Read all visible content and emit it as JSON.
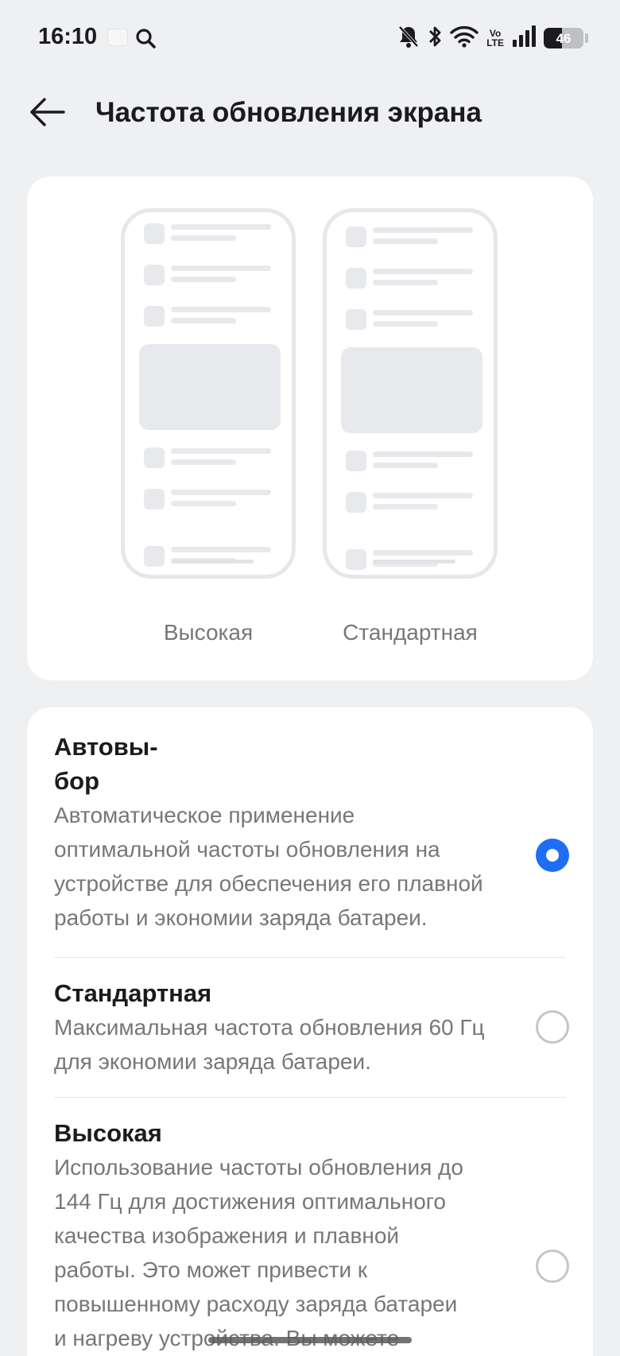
{
  "status_bar": {
    "time": "16:10",
    "volte_top": "Vo",
    "volte_bottom": "LTE",
    "battery_level": 0.46,
    "battery_text": "46",
    "icons": [
      "mute-icon",
      "bluetooth-icon",
      "wifi-icon",
      "volte-icon",
      "signal-icon",
      "battery-icon"
    ]
  },
  "header": {
    "title": "Частота обновления экрана",
    "back_icon": "arrow-left-icon"
  },
  "preview": {
    "left_label": "Высокая",
    "right_label": "Стандартная"
  },
  "options": [
    {
      "title_line1": "Автовы-",
      "title_line2": "бор",
      "desc_lines": [
        "Автоматическое применение",
        "оптимальной частоты обновления на",
        "устройстве для обеспечения его плавной",
        "работы и экономии заряда батареи."
      ],
      "selected": true
    },
    {
      "title": "Стандартная",
      "desc_lines": [
        "Максимальная частота обновления 60 Гц",
        "для экономии заряда батареи."
      ],
      "selected": false
    },
    {
      "title": "Высокая",
      "desc_lines": [
        "Использование частоты обновления до",
        "144 Гц для достижения оптимального",
        "качества изображения и плавной",
        "работы. Это может привести к",
        "повышенному расходу заряда батареи",
        "и нагреву устройства. Вы можете"
      ],
      "selected": false
    }
  ],
  "colors": {
    "accent": "#1f6df4",
    "background": "#eff0f2",
    "card": "#ffffff",
    "secondary_text": "#77777b"
  }
}
